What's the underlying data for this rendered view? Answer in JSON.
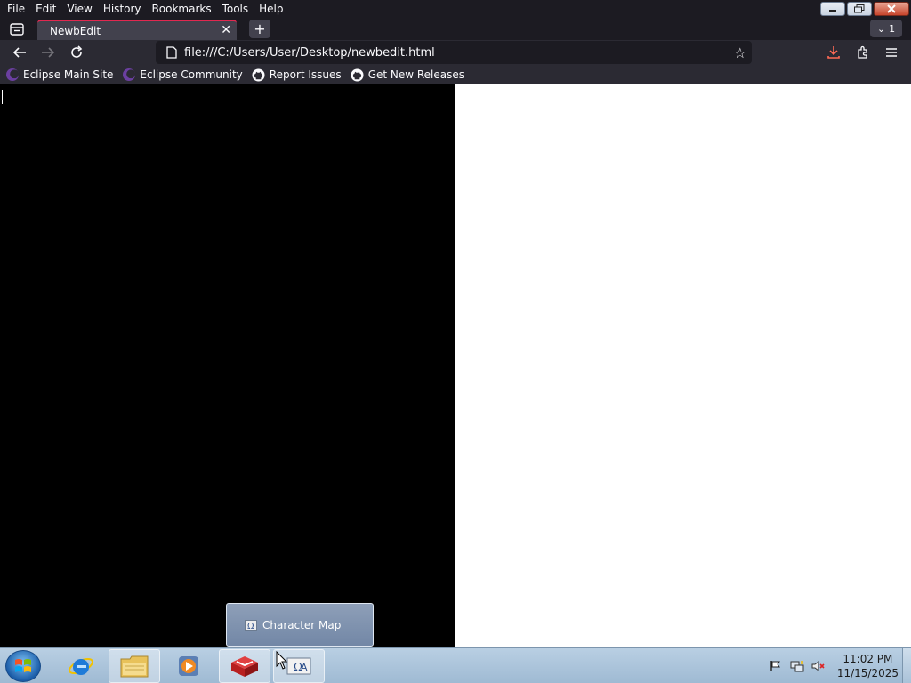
{
  "menubar": {
    "items": [
      {
        "label": "File"
      },
      {
        "label": "Edit"
      },
      {
        "label": "View"
      },
      {
        "label": "History"
      },
      {
        "label": "Bookmarks"
      },
      {
        "label": "Tools"
      },
      {
        "label": "Help"
      }
    ]
  },
  "tabs": {
    "active_title": "NewbEdit",
    "count": "1"
  },
  "navbar": {
    "url": "file:///C:/Users/User/Desktop/newbedit.html"
  },
  "bookmarks": [
    {
      "label": "Eclipse Main Site",
      "icon": "eclipse-icon"
    },
    {
      "label": "Eclipse Community",
      "icon": "eclipse-icon"
    },
    {
      "label": "Report Issues",
      "icon": "github-icon"
    },
    {
      "label": "Get New Releases",
      "icon": "github-icon"
    }
  ],
  "taskbar": {
    "popup_label": "Character Map",
    "clock_time": "11:02 PM",
    "clock_date": "11/15/2025"
  },
  "colors": {
    "browser_chrome": "#1c1b22",
    "toolbar": "#2b2a33",
    "tab_accent": "#e22850",
    "editor_bg": "#000000",
    "preview_bg": "#ffffff"
  }
}
